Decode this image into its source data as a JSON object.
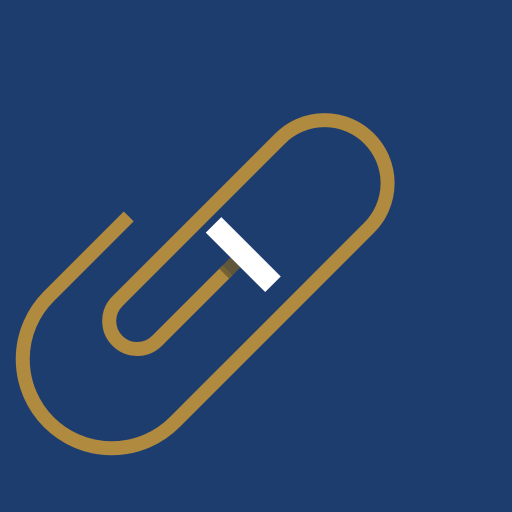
{
  "app_icon": {
    "icon": "paperclip-icon",
    "colors": {
      "background": "#1e3d6f",
      "clip": "#b08a3e",
      "clip_shadow": "#6b5a32",
      "tab": "#ffffff"
    }
  }
}
